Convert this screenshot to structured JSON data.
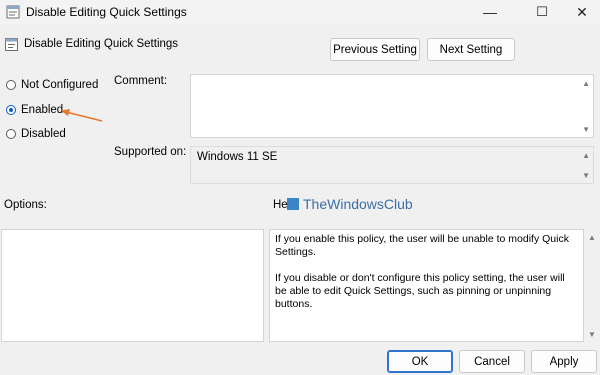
{
  "window": {
    "title": "Disable Editing Quick Settings",
    "controls": {
      "minimize": "—",
      "maximize": "☐",
      "close": "✕"
    }
  },
  "header": {
    "setting_name": "Disable Editing Quick Settings",
    "previous_label": "Previous Setting",
    "next_label": "Next Setting"
  },
  "state": {
    "options": [
      "Not Configured",
      "Enabled",
      "Disabled"
    ],
    "selected": "Enabled"
  },
  "comment": {
    "label": "Comment:",
    "value": ""
  },
  "supported": {
    "label": "Supported on:",
    "value": "Windows 11 SE"
  },
  "options_panel": {
    "label": "Options:"
  },
  "help": {
    "label": "Help:",
    "paragraphs": [
      "If you enable this policy, the user will be unable to modify Quick Settings.",
      "If you disable or don't configure this policy setting, the user will be able to edit Quick Settings, such as pinning or unpinning buttons."
    ]
  },
  "watermark": {
    "text": "TheWindowsClub"
  },
  "footer": {
    "ok_label": "OK",
    "cancel_label": "Cancel",
    "apply_label": "Apply"
  },
  "colors": {
    "accent": "#0a5ec7",
    "annotation_arrow": "#e8762b"
  }
}
